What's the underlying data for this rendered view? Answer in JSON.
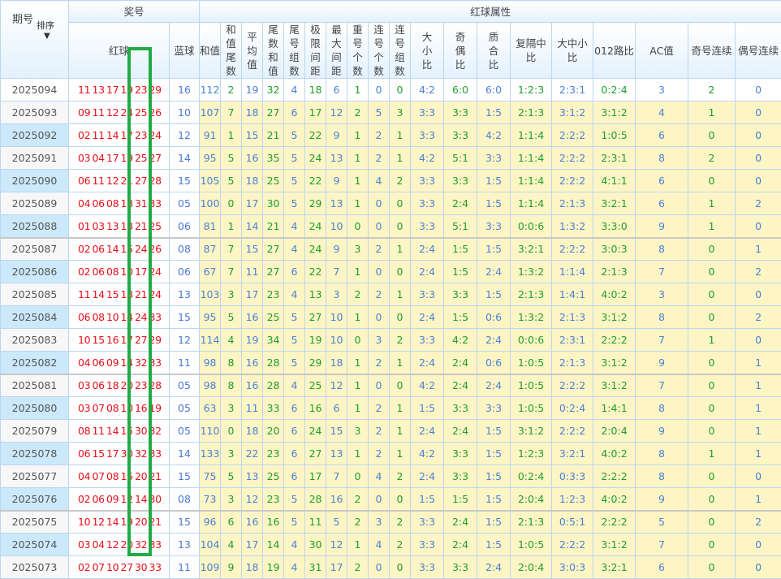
{
  "header": {
    "period_label": "期号",
    "sort_label": "排序",
    "prize_group": "奖号",
    "red_ball": "红球",
    "blue_ball": "蓝球",
    "attr_group": "红球属性",
    "columns": [
      "和值",
      "和值尾数",
      "平均值",
      "尾数和值",
      "尾号组数",
      "极限间距",
      "最大间距",
      "重号个数",
      "连号个数",
      "连号组数",
      "大小比",
      "奇偶比",
      "质合比",
      "复隔中比",
      "大中小比",
      "012路比",
      "AC值",
      "奇号连续",
      "偶号连续"
    ]
  },
  "colors": {
    "red": "#e8101a",
    "blue": "#4a79d8",
    "green": "#1f9e2e",
    "highlight_box": "#22aa44",
    "attr_bg": "#fdf5c4"
  },
  "rows": [
    {
      "period": "2025094",
      "red": [
        "11",
        "13",
        "17",
        "19",
        "23",
        "29"
      ],
      "blue": "16",
      "attrs": [
        "112",
        "2",
        "19",
        "32",
        "4",
        "18",
        "6",
        "1",
        "0",
        "0",
        "4:2",
        "6:0",
        "6:0",
        "1:2:3",
        "2:3:1",
        "0:2:4",
        "3",
        "2",
        "0"
      ]
    },
    {
      "period": "2025093",
      "red": [
        "09",
        "11",
        "12",
        "24",
        "25",
        "26"
      ],
      "blue": "10",
      "attrs": [
        "107",
        "7",
        "18",
        "27",
        "6",
        "17",
        "12",
        "2",
        "5",
        "3",
        "3:3",
        "3:3",
        "1:5",
        "2:1:3",
        "3:1:2",
        "3:1:2",
        "4",
        "1",
        "0"
      ]
    },
    {
      "period": "2025092",
      "red": [
        "02",
        "11",
        "14",
        "17",
        "23",
        "24"
      ],
      "blue": "12",
      "attrs": [
        "91",
        "1",
        "15",
        "21",
        "5",
        "22",
        "9",
        "1",
        "2",
        "1",
        "3:3",
        "3:3",
        "4:2",
        "1:1:4",
        "2:2:2",
        "1:0:5",
        "6",
        "0",
        "0"
      ]
    },
    {
      "period": "2025091",
      "red": [
        "03",
        "04",
        "17",
        "19",
        "25",
        "27"
      ],
      "blue": "14",
      "attrs": [
        "95",
        "5",
        "16",
        "35",
        "5",
        "24",
        "13",
        "1",
        "2",
        "1",
        "4:2",
        "5:1",
        "3:3",
        "1:1:4",
        "2:2:2",
        "2:3:1",
        "8",
        "2",
        "0"
      ]
    },
    {
      "period": "2025090",
      "red": [
        "06",
        "11",
        "12",
        "21",
        "27",
        "28"
      ],
      "blue": "15",
      "attrs": [
        "105",
        "5",
        "18",
        "25",
        "5",
        "22",
        "9",
        "1",
        "4",
        "2",
        "3:3",
        "3:3",
        "1:5",
        "1:1:4",
        "2:2:2",
        "4:1:1",
        "6",
        "0",
        "0"
      ]
    },
    {
      "period": "2025089",
      "red": [
        "04",
        "06",
        "08",
        "18",
        "31",
        "33"
      ],
      "blue": "05",
      "attrs": [
        "100",
        "0",
        "17",
        "30",
        "5",
        "29",
        "13",
        "1",
        "0",
        "0",
        "3:3",
        "2:4",
        "1:5",
        "1:1:4",
        "2:1:3",
        "3:2:1",
        "6",
        "1",
        "2"
      ]
    },
    {
      "period": "2025088",
      "red": [
        "01",
        "03",
        "13",
        "18",
        "21",
        "25"
      ],
      "blue": "06",
      "attrs": [
        "81",
        "1",
        "14",
        "21",
        "4",
        "24",
        "10",
        "0",
        "0",
        "0",
        "3:3",
        "5:1",
        "3:3",
        "0:0:6",
        "1:3:2",
        "3:3:0",
        "9",
        "1",
        "0"
      ]
    },
    {
      "period": "2025087",
      "red": [
        "02",
        "06",
        "14",
        "15",
        "24",
        "26"
      ],
      "blue": "08",
      "attrs": [
        "87",
        "7",
        "15",
        "27",
        "4",
        "24",
        "9",
        "3",
        "2",
        "1",
        "2:4",
        "1:5",
        "1:5",
        "3:2:1",
        "2:2:2",
        "3:0:3",
        "8",
        "0",
        "1"
      ]
    },
    {
      "period": "2025086",
      "red": [
        "02",
        "06",
        "08",
        "10",
        "17",
        "24"
      ],
      "blue": "06",
      "attrs": [
        "67",
        "7",
        "11",
        "27",
        "6",
        "22",
        "7",
        "1",
        "0",
        "0",
        "2:4",
        "1:5",
        "2:4",
        "1:3:2",
        "1:1:4",
        "2:1:3",
        "7",
        "0",
        "2"
      ]
    },
    {
      "period": "2025085",
      "red": [
        "11",
        "14",
        "15",
        "18",
        "21",
        "24"
      ],
      "blue": "13",
      "attrs": [
        "103",
        "3",
        "17",
        "23",
        "4",
        "13",
        "3",
        "2",
        "2",
        "1",
        "3:3",
        "3:3",
        "1:5",
        "2:1:3",
        "1:4:1",
        "4:0:2",
        "3",
        "0",
        "0"
      ]
    },
    {
      "period": "2025084",
      "red": [
        "06",
        "08",
        "10",
        "14",
        "24",
        "33"
      ],
      "blue": "15",
      "attrs": [
        "95",
        "5",
        "16",
        "25",
        "5",
        "27",
        "10",
        "1",
        "0",
        "0",
        "2:4",
        "1:5",
        "0:6",
        "1:3:2",
        "2:1:3",
        "3:1:2",
        "8",
        "0",
        "2"
      ]
    },
    {
      "period": "2025083",
      "red": [
        "10",
        "15",
        "16",
        "17",
        "27",
        "29"
      ],
      "blue": "12",
      "attrs": [
        "114",
        "4",
        "19",
        "34",
        "5",
        "19",
        "10",
        "0",
        "3",
        "2",
        "3:3",
        "4:2",
        "2:4",
        "0:0:6",
        "2:3:1",
        "2:2:2",
        "7",
        "1",
        "0"
      ]
    },
    {
      "period": "2025082",
      "red": [
        "04",
        "06",
        "09",
        "14",
        "32",
        "33"
      ],
      "blue": "11",
      "attrs": [
        "98",
        "8",
        "16",
        "28",
        "5",
        "29",
        "18",
        "1",
        "2",
        "1",
        "2:4",
        "2:4",
        "0:6",
        "1:0:5",
        "2:1:3",
        "3:1:2",
        "9",
        "0",
        "1"
      ]
    },
    {
      "period": "2025081",
      "red": [
        "03",
        "06",
        "18",
        "20",
        "23",
        "28"
      ],
      "blue": "05",
      "attrs": [
        "98",
        "8",
        "16",
        "28",
        "4",
        "25",
        "12",
        "1",
        "0",
        "0",
        "4:2",
        "2:4",
        "2:4",
        "1:0:5",
        "2:2:2",
        "3:1:2",
        "7",
        "0",
        "1"
      ]
    },
    {
      "period": "2025080",
      "red": [
        "03",
        "07",
        "08",
        "10",
        "16",
        "19"
      ],
      "blue": "05",
      "attrs": [
        "63",
        "3",
        "11",
        "33",
        "6",
        "16",
        "6",
        "1",
        "2",
        "1",
        "1:5",
        "3:3",
        "3:3",
        "1:0:5",
        "0:2:4",
        "1:4:1",
        "8",
        "0",
        "1"
      ]
    },
    {
      "period": "2025079",
      "red": [
        "08",
        "11",
        "14",
        "15",
        "30",
        "32"
      ],
      "blue": "05",
      "attrs": [
        "110",
        "0",
        "18",
        "20",
        "6",
        "24",
        "15",
        "3",
        "2",
        "1",
        "2:4",
        "2:4",
        "1:5",
        "3:1:2",
        "2:2:2",
        "2:0:4",
        "9",
        "0",
        "1"
      ]
    },
    {
      "period": "2025078",
      "red": [
        "06",
        "15",
        "17",
        "30",
        "32",
        "33"
      ],
      "blue": "14",
      "attrs": [
        "133",
        "3",
        "22",
        "23",
        "6",
        "27",
        "13",
        "1",
        "2",
        "1",
        "4:2",
        "3:3",
        "1:5",
        "1:2:3",
        "3:2:1",
        "4:0:2",
        "8",
        "1",
        "1"
      ]
    },
    {
      "period": "2025077",
      "red": [
        "04",
        "07",
        "08",
        "15",
        "20",
        "21"
      ],
      "blue": "15",
      "attrs": [
        "75",
        "5",
        "13",
        "25",
        "6",
        "17",
        "7",
        "0",
        "4",
        "2",
        "2:4",
        "3:3",
        "1:5",
        "0:2:4",
        "0:3:3",
        "2:2:2",
        "8",
        "0",
        "0"
      ]
    },
    {
      "period": "2025076",
      "red": [
        "02",
        "06",
        "09",
        "12",
        "14",
        "30"
      ],
      "blue": "08",
      "attrs": [
        "73",
        "3",
        "12",
        "23",
        "5",
        "28",
        "16",
        "2",
        "0",
        "0",
        "1:5",
        "1:5",
        "1:5",
        "2:0:4",
        "1:2:3",
        "4:0:2",
        "9",
        "0",
        "1"
      ]
    },
    {
      "period": "2025075",
      "red": [
        "10",
        "12",
        "14",
        "19",
        "20",
        "21"
      ],
      "blue": "15",
      "attrs": [
        "96",
        "6",
        "16",
        "16",
        "5",
        "11",
        "5",
        "2",
        "3",
        "2",
        "3:3",
        "2:4",
        "1:5",
        "2:1:3",
        "0:5:1",
        "2:2:2",
        "5",
        "0",
        "2"
      ]
    },
    {
      "period": "2025074",
      "red": [
        "03",
        "04",
        "12",
        "20",
        "32",
        "33"
      ],
      "blue": "13",
      "attrs": [
        "104",
        "4",
        "17",
        "14",
        "4",
        "30",
        "12",
        "1",
        "4",
        "2",
        "3:3",
        "2:4",
        "1:5",
        "1:0:5",
        "2:2:2",
        "3:1:2",
        "7",
        "0",
        "0"
      ]
    },
    {
      "period": "2025073",
      "red": [
        "02",
        "07",
        "10",
        "27",
        "30",
        "33"
      ],
      "blue": "11",
      "attrs": [
        "109",
        "9",
        "18",
        "19",
        "4",
        "31",
        "17",
        "2",
        "0",
        "0",
        "3:3",
        "3:3",
        "2:4",
        "2:0:4",
        "3:0:3",
        "3:2:1",
        "6",
        "0",
        "0"
      ]
    }
  ]
}
